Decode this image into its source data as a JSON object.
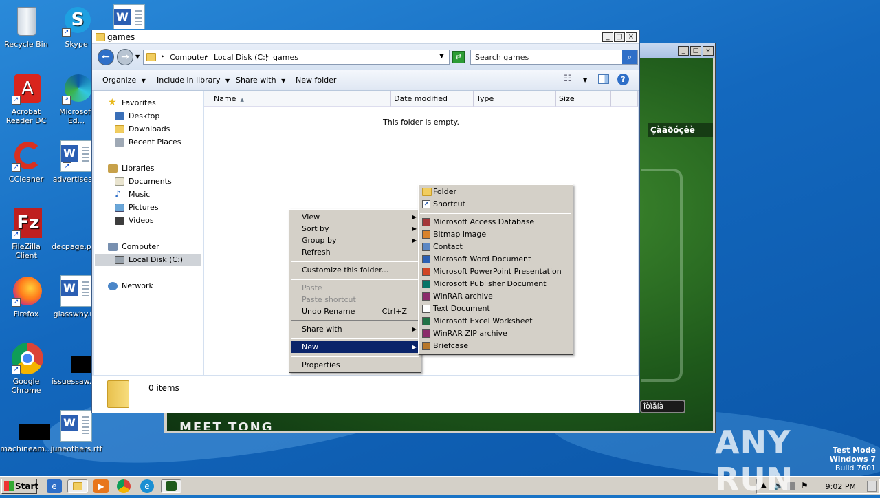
{
  "desktop": {
    "icons": [
      {
        "label": "Recycle Bin"
      },
      {
        "label": "Skype"
      },
      {
        "label": "Acrobat Reader DC"
      },
      {
        "label": "Microsoft Ed..."
      },
      {
        "label": "CCleaner"
      },
      {
        "label": "advertisea..."
      },
      {
        "label": "FileZilla Client"
      },
      {
        "label": "decpage.pr..."
      },
      {
        "label": "Firefox"
      },
      {
        "label": "glasswhy.r..."
      },
      {
        "label": "Google Chrome"
      },
      {
        "label": "issuessaw.j..."
      },
      {
        "label": "machineam..."
      },
      {
        "label": "juneothers.rtf"
      }
    ]
  },
  "game_window": {
    "header_text": "Çàãðóçêè",
    "button_text": "îòìåíà",
    "bottom_text": "MEET TONG"
  },
  "explorer": {
    "title": "games",
    "breadcrumb": [
      "Computer",
      "Local Disk (C:)",
      "games"
    ],
    "search_placeholder": "Search games",
    "toolbar": {
      "organize": "Organize",
      "include_in_library": "Include in library",
      "share_with": "Share with",
      "new_folder": "New folder"
    },
    "nav": {
      "favorites": "Favorites",
      "desktop": "Desktop",
      "downloads": "Downloads",
      "recent_places": "Recent Places",
      "libraries": "Libraries",
      "documents": "Documents",
      "music": "Music",
      "pictures": "Pictures",
      "videos": "Videos",
      "computer": "Computer",
      "local_disk": "Local Disk (C:)",
      "network": "Network"
    },
    "columns": {
      "name": "Name",
      "date_modified": "Date modified",
      "type": "Type",
      "size": "Size"
    },
    "empty_text": "This folder is empty.",
    "item_count": "0 items"
  },
  "context_menu": {
    "view": "View",
    "sort_by": "Sort by",
    "group_by": "Group by",
    "refresh": "Refresh",
    "customize": "Customize this folder...",
    "paste": "Paste",
    "paste_shortcut": "Paste shortcut",
    "undo_rename": "Undo Rename",
    "undo_shortcut": "Ctrl+Z",
    "share_with": "Share with",
    "new": "New",
    "properties": "Properties"
  },
  "new_submenu": {
    "folder": "Folder",
    "shortcut": "Shortcut",
    "items": [
      {
        "label": "Microsoft Access Database",
        "icon": "access-icon",
        "color": "#a4373a"
      },
      {
        "label": "Bitmap image",
        "icon": "bitmap-icon",
        "color": "#d9822b"
      },
      {
        "label": "Contact",
        "icon": "contact-icon",
        "color": "#5b87c4"
      },
      {
        "label": "Microsoft Word Document",
        "icon": "word-icon",
        "color": "#2b5fb3"
      },
      {
        "label": "Microsoft PowerPoint Presentation",
        "icon": "powerpoint-icon",
        "color": "#d04423"
      },
      {
        "label": "Microsoft Publisher Document",
        "icon": "publisher-icon",
        "color": "#077568"
      },
      {
        "label": "WinRAR archive",
        "icon": "winrar-icon",
        "color": "#8b2c6b"
      },
      {
        "label": "Text Document",
        "icon": "text-icon",
        "color": "#ffffff"
      },
      {
        "label": "Microsoft Excel Worksheet",
        "icon": "excel-icon",
        "color": "#207245"
      },
      {
        "label": "WinRAR ZIP archive",
        "icon": "winrar-zip-icon",
        "color": "#8b2c6b"
      },
      {
        "label": "Briefcase",
        "icon": "briefcase-icon",
        "color": "#b8772a"
      }
    ]
  },
  "taskbar": {
    "start": "Start",
    "clock": "9:02 PM"
  },
  "watermark": {
    "anyrun": "ANY RUN",
    "test_mode": "Test Mode",
    "os": "Windows 7",
    "build": "Build 7601"
  }
}
